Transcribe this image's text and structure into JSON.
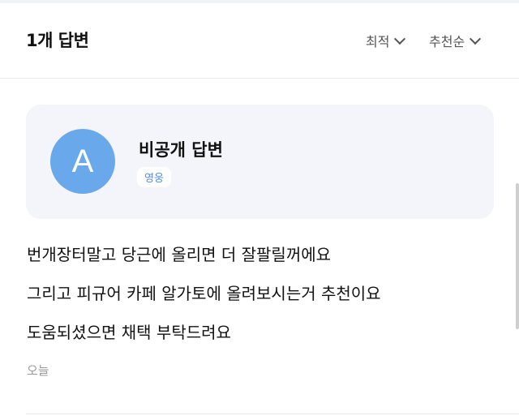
{
  "header": {
    "answer_count": "1개 답변",
    "sort_latest": "최적",
    "sort_recommended": "추천순"
  },
  "answer": {
    "avatar_letter": "A",
    "author": "비공개 답변",
    "badge": "영웅",
    "lines": [
      "번개장터말고 당근에 올리면 더 잘팔릴꺼에요",
      "그리고 피규어 카페 알가토에 올려보시는거 추천이요",
      "도움되셨으면 채택 부탁드려요"
    ],
    "timestamp": "오늘"
  },
  "colors": {
    "avatar_bg": "#6aa8ec",
    "card_bg": "#f3f5fa",
    "badge_text": "#4a8de0"
  }
}
